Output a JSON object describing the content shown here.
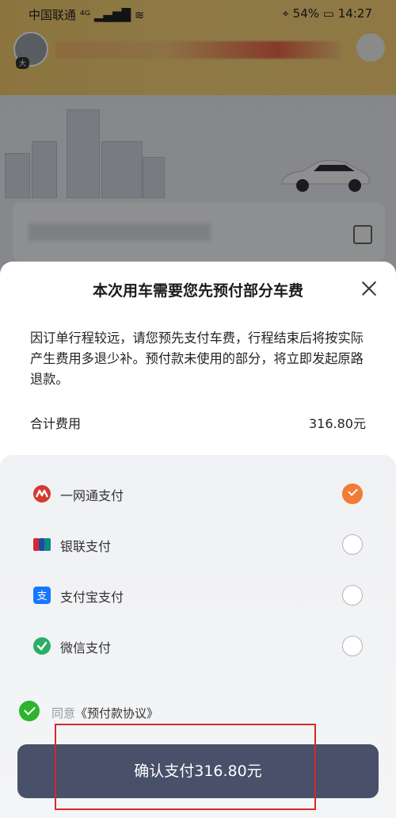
{
  "status_bar": {
    "carrier": "中国联通 ⁴ᴳ ▂▄▆█ ≋",
    "battery_percent": "54%",
    "time": "14:27"
  },
  "background": {
    "avatar_tag": "大"
  },
  "modal": {
    "title": "本次用车需要您先预付部分车费",
    "notice": "因订单行程较远，请您预先支付车费，行程结束后将按实际产生费用多退少补。预付款未使用的部分，将立即发起原路退款。",
    "total_label": "合计费用",
    "total_value": "316.80元",
    "payment_methods": [
      {
        "label": "一网通支付",
        "icon": "yiwangtong-icon",
        "color": "#d43a2f",
        "selected": true
      },
      {
        "label": "银联支付",
        "icon": "unionpay-icon",
        "color": "#1a7a9e",
        "selected": false
      },
      {
        "label": "支付宝支付",
        "icon": "alipay-icon",
        "color": "#1677ff",
        "selected": false
      },
      {
        "label": "微信支付",
        "icon": "wechat-pay-icon",
        "color": "#2aae67",
        "selected": false
      }
    ],
    "agreement": {
      "prefix": "同意",
      "link": "《预付款协议》"
    },
    "confirm_button": "确认支付316.80元"
  },
  "colors": {
    "accent": "#f07c35",
    "button": "#48506a",
    "agree": "#2cb52c",
    "highlight": "#d42a2a"
  }
}
